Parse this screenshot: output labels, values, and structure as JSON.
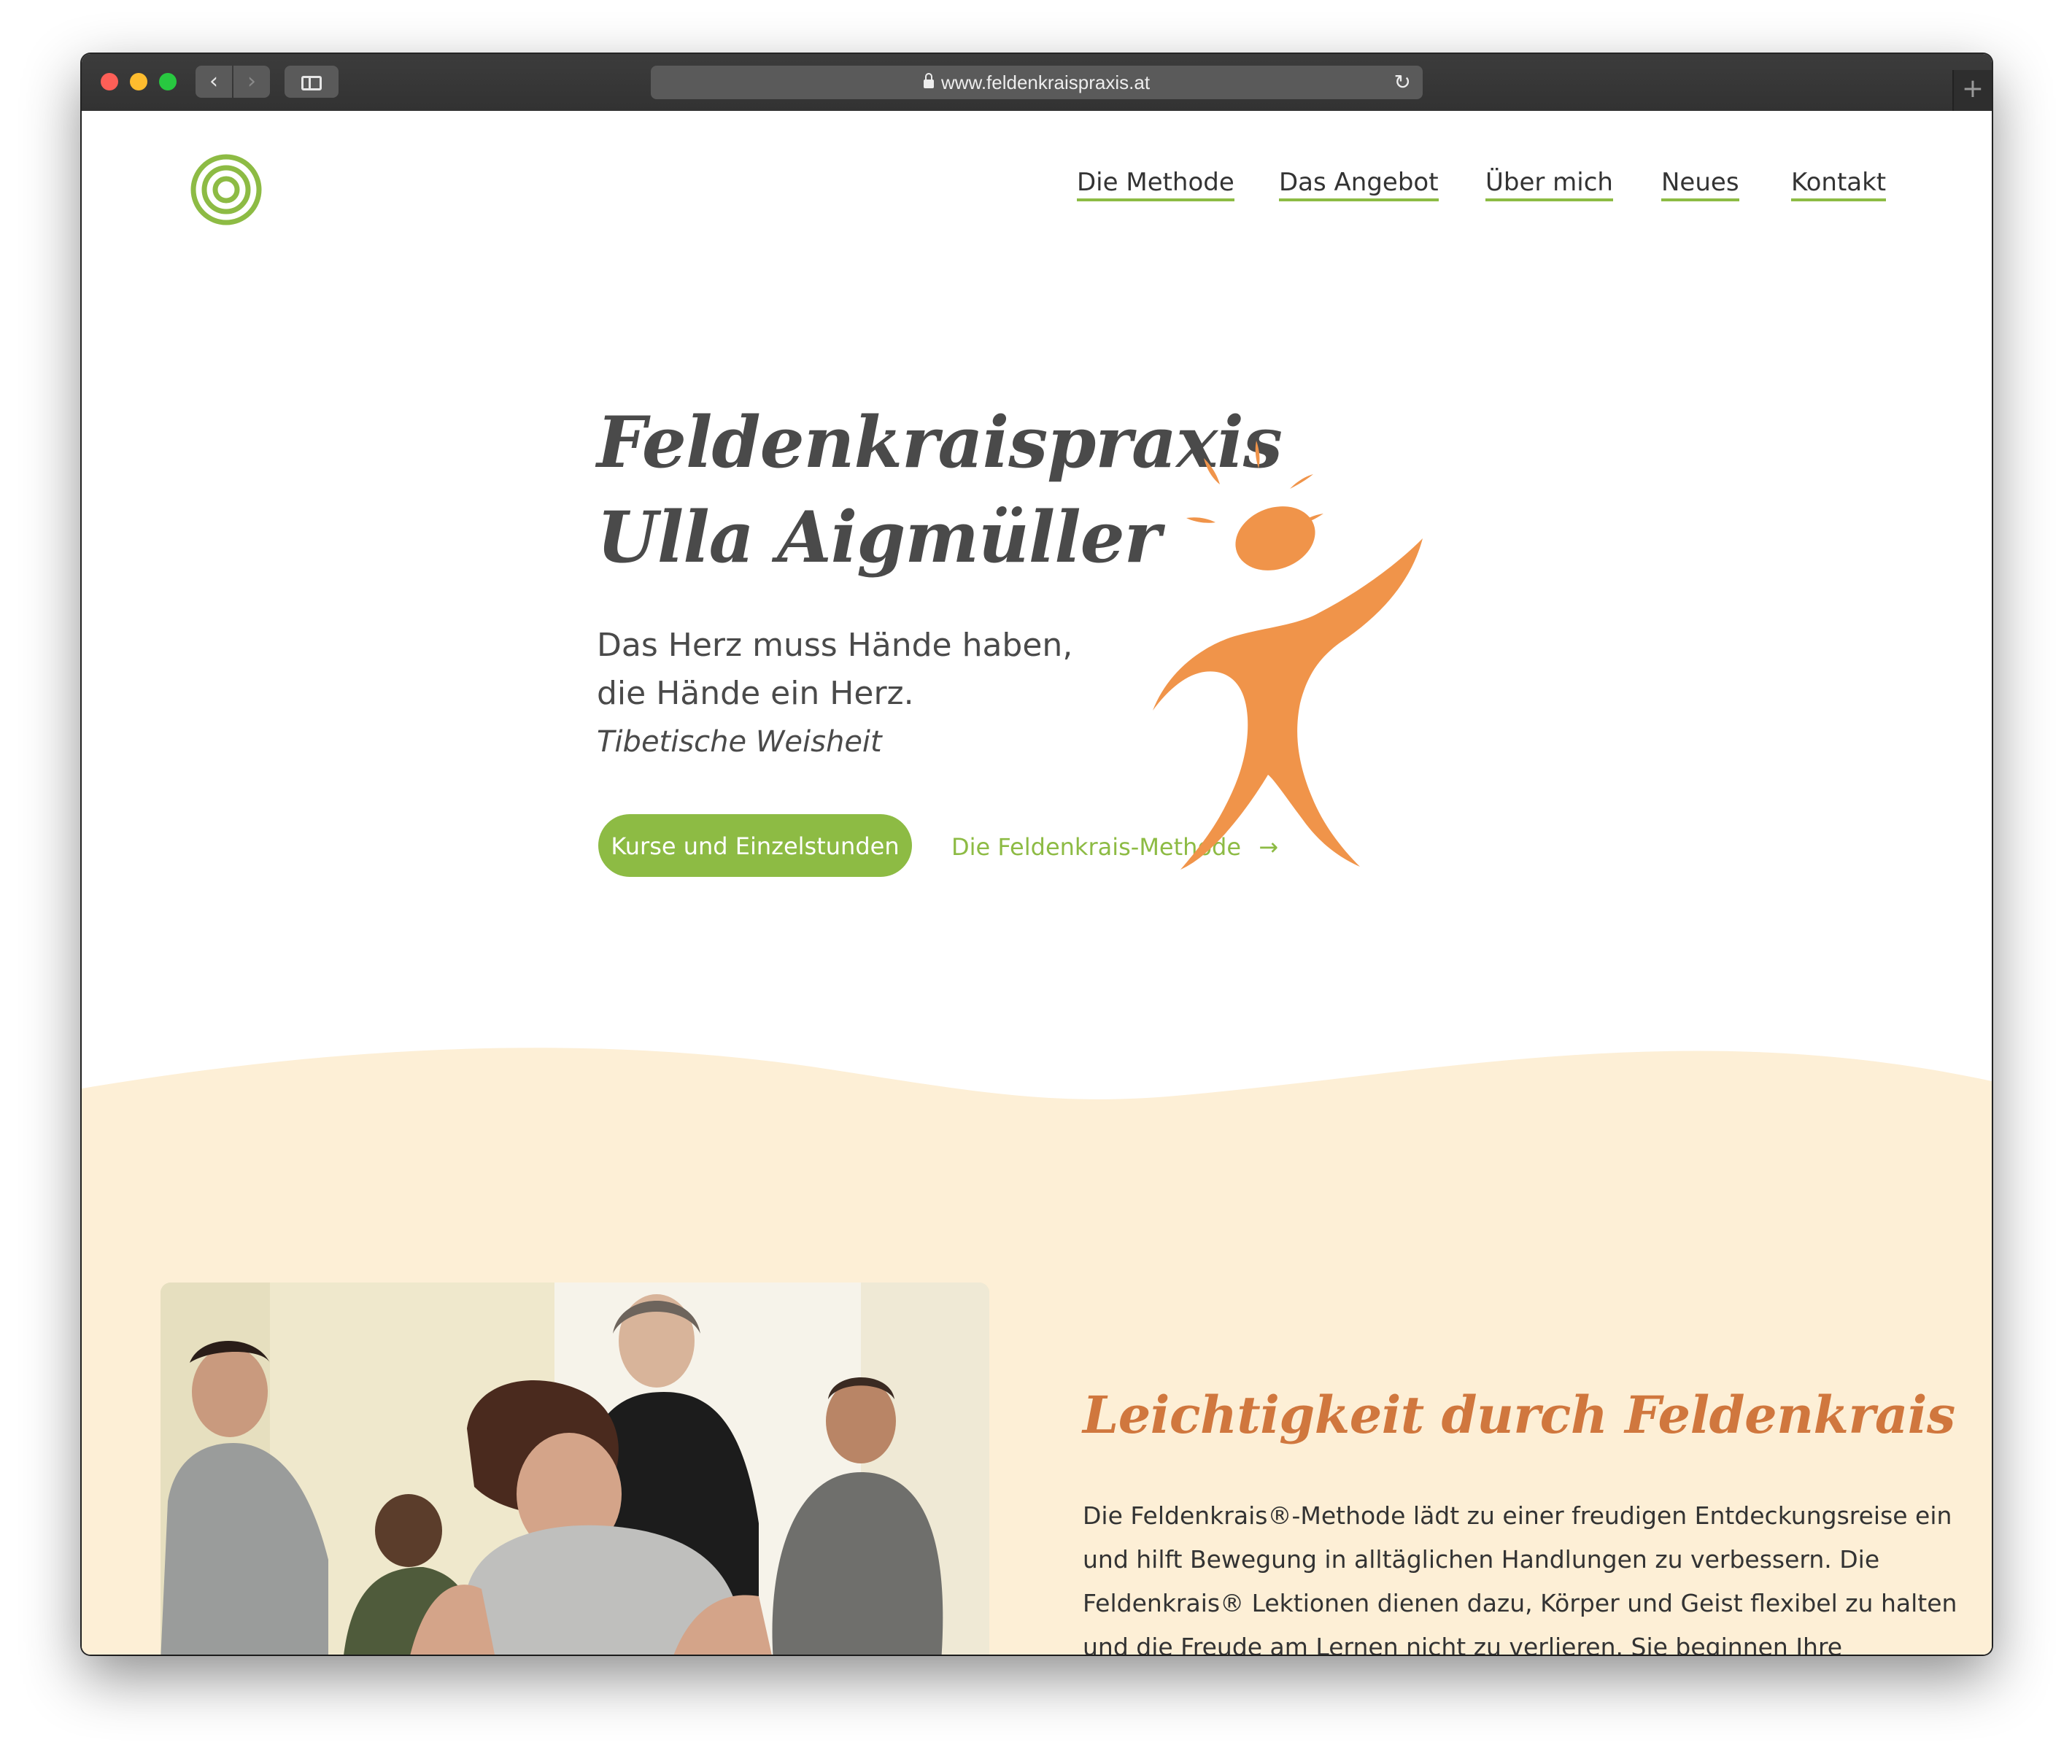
{
  "browser": {
    "url": "www.feldenkraispraxis.at"
  },
  "nav": {
    "items": [
      "Die Methode",
      "Das Angebot",
      "Über mich",
      "Neues",
      "Kontakt"
    ]
  },
  "hero": {
    "title_line1": "Feldenkraispraxis",
    "title_line2": "Ulla Aigmüller",
    "quote_line1": "Das Herz muss Hände haben,",
    "quote_line2": "die Hände ein Herz.",
    "quote_source": "Tibetische Weisheit",
    "primary_button": "Kurse und Einzelstunden",
    "secondary_link": "Die Feldenkrais-Methode",
    "secondary_arrow": "→"
  },
  "section": {
    "title": "Leichtigkeit durch Feldenkrais",
    "lines": [
      "Die Feldenkrais®-Methode lädt zu einer freudigen Entdeckungsreise ein",
      "und hilft Bewegung in alltäglichen Handlungen zu verbessern. Die",
      "Feldenkrais® Lektionen dienen dazu, Körper und Geist flexibel zu halten",
      "und die Freude am Lernen nicht zu verlieren. Sie beginnen Ihre"
    ]
  },
  "colors": {
    "accent_green": "#8dbb44",
    "accent_orange": "#f0944a",
    "heading_orange": "#d0773e",
    "cream": "#fdefd6",
    "text_dark": "#4a4a4a"
  }
}
